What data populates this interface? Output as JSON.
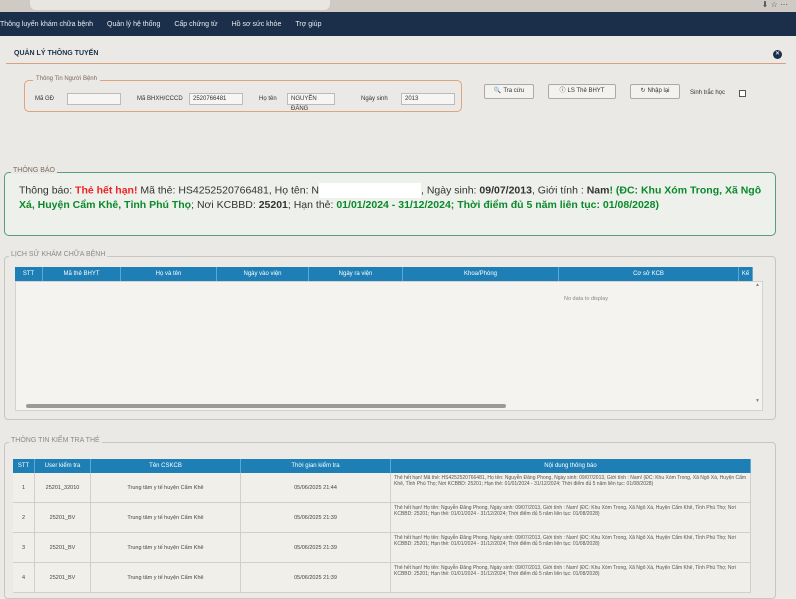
{
  "nav": {
    "items": [
      "Thông luyến khám chữa bệnh",
      "Quản lý hệ thống",
      "Cấp chứng từ",
      "Hồ sơ sức khỏe",
      "Trợ giúp"
    ]
  },
  "page_title": "QUẢN LÝ THÔNG TUYẾN",
  "search": {
    "legend": "Thông Tin Người Bệnh",
    "ma_gd_label": "Mã GĐ",
    "ma_gd_value": "",
    "ma_bhxh_label": "Mã BHXH/CCCD",
    "ma_bhxh_value": "2520766481",
    "ho_ten_label": "Họ tên",
    "ho_ten_value": "NGUYỄN ĐĂNG",
    "ngay_sinh_label": "Ngày sinh",
    "ngay_sinh_value": "2013"
  },
  "buttons": {
    "tra_cuu": "Tra cứu",
    "ls_the": "LS Thẻ BHYT",
    "nhap_lai": "Nhập lại",
    "sinh_trac_hoc": "Sinh trắc học"
  },
  "notice": {
    "legend": "THÔNG BÁO",
    "prefix": "Thông báo: ",
    "status": "Thẻ hết hạn!",
    "ma_the": " Mã thẻ: HS4252520766481, Họ tên: N",
    "ngay_sinh_label": ", Ngày sinh: ",
    "ngay_sinh": "09/07/2013",
    "gioi_tinh_label": ", Giới tính : ",
    "gioi_tinh": "Nam",
    "address": "! (ĐC: Khu Xóm Trong, Xã Ngô Xá, Huyện Cẩm Khê, Tỉnh Phú Thọ",
    "kcbbd_label": "; Nơi KCBBD: ",
    "kcbbd": "25201",
    "han_the_label": "; Hạn thẻ: ",
    "han_the": "01/01/2024 - 31/12/2024",
    "thoi_diem": "; Thời điểm đủ 5 năm liên tục: 01/08/2028)"
  },
  "history": {
    "legend": "LỊCH SỬ KHÁM CHỮA BỆNH",
    "columns": [
      "STT",
      "Mã thẻ BHYT",
      "Họ và tên",
      "Ngày vào viện",
      "Ngày ra viện",
      "Khoa/Phòng",
      "Cơ sở KCB",
      "Kế"
    ],
    "no_data": "No data to display"
  },
  "check": {
    "legend": "THÔNG TIN KIỂM TRA THẺ",
    "columns": [
      "STT",
      "User kiểm tra",
      "Tên CSKCB",
      "Thời gian kiểm tra",
      "Nội dung thông báo"
    ],
    "rows": [
      {
        "stt": "1",
        "user": "25201_32010",
        "cskcb": "Trung tâm y tế huyện Cẩm Khê",
        "time": "05/06/2025 21:44",
        "msg": "Thẻ hết hạn! Mã thẻ: HS4252520766481, Họ tên: Nguyễn Đăng Phong, Ngày sinh: 09/07/2013, Giới tính : Nam! (ĐC: Khu Xóm Trong, Xã Ngô Xá, Huyện Cẩm Khê, Tỉnh Phú Thọ; Nơi KCBBD: 25201; Hạn thẻ: 01/01/2024 - 31/12/2024; Thời điểm đủ 5 năm liên tục: 01/08/2028)"
      },
      {
        "stt": "2",
        "user": "25201_BV",
        "cskcb": "Trung tâm y tế huyện Cẩm Khê",
        "time": "05/06/2025 21:39",
        "msg": "Thẻ hết hạn! Họ tên: Nguyễn Đăng Phong, Ngày sinh: 09/07/2013, Giới tính : Nam! (ĐC: Khu Xóm Trong, Xã Ngô Xá, Huyện Cẩm Khê, Tỉnh Phú Thọ; Nơi KCBBD: 25201; Hạn thẻ: 01/01/2024 - 31/12/2024; Thời điểm đủ 5 năm liên tục: 01/08/2028)"
      },
      {
        "stt": "3",
        "user": "25201_BV",
        "cskcb": "Trung tâm y tế huyện Cẩm Khê",
        "time": "05/06/2025 21:39",
        "msg": "Thẻ hết hạn! Họ tên: Nguyễn Đăng Phong, Ngày sinh: 09/07/2013, Giới tính : Nam! (ĐC: Khu Xóm Trong, Xã Ngô Xá, Huyện Cẩm Khê, Tỉnh Phú Thọ; Nơi KCBBD: 25201; Hạn thẻ: 01/01/2024 - 31/12/2024; Thời điểm đủ 5 năm liên tục: 01/08/2028)"
      },
      {
        "stt": "4",
        "user": "25201_BV",
        "cskcb": "Trung tâm y tế huyện Cẩm Khê",
        "time": "05/06/2025 21:39",
        "msg": "Thẻ hết hạn! Họ tên: Nguyễn Đăng Phong, Ngày sinh: 09/07/2013, Giới tính : Nam! (ĐC: Khu Xóm Trong, Xã Ngô Xá, Huyện Cẩm Khê, Tỉnh Phú Thọ; Nơi KCBBD: 25201; Hạn thẻ: 01/01/2024 - 31/12/2024; Thời điểm đủ 5 năm liên tục: 01/08/2028)"
      }
    ]
  },
  "colors": {
    "navbar": "#1b2f4a",
    "table_header": "#1d7fb6",
    "status_red": "#e22222",
    "status_green": "#0a8a2a"
  }
}
